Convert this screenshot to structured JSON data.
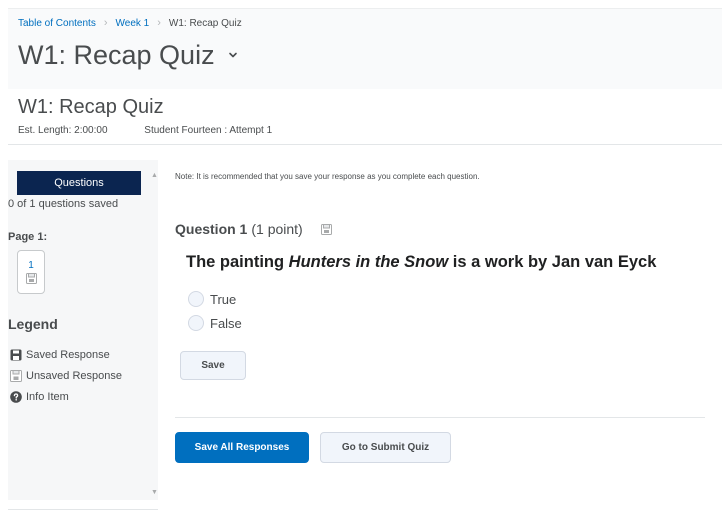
{
  "breadcrumb": {
    "items": [
      "Table of Contents",
      "Week 1",
      "W1: Recap Quiz"
    ],
    "separator": "›"
  },
  "page_title": "W1: Recap Quiz",
  "quiz": {
    "title": "W1: Recap Quiz",
    "est_length": "Est. Length: 2:00:00",
    "attempt": "Student Fourteen : Attempt 1"
  },
  "sidebar": {
    "tab": "Questions",
    "saved_count": "0 of 1 questions saved",
    "page_label": "Page 1:",
    "page_number": "1",
    "legend_title": "Legend",
    "legend": {
      "saved": "Saved Response",
      "unsaved": "Unsaved Response",
      "info": "Info Item"
    }
  },
  "note": "Note: It is recommended that you save your response as you complete each question.",
  "question": {
    "number": "Question 1",
    "points": "(1 point)",
    "text_before": "The painting ",
    "text_italic": "Hunters in the Snow",
    "text_after": " is a work by Jan van Eyck",
    "options": [
      "True",
      "False"
    ],
    "save_label": "Save"
  },
  "actions": {
    "save_all": "Save All Responses",
    "submit": "Go to Submit Quiz"
  },
  "colors": {
    "accent": "#006fbf",
    "tab_dark": "#0b2550"
  },
  "icons": {
    "title_menu": "chevron-down-icon",
    "saved": "floppy-disk-icon",
    "unsaved": "unsaved-disk-icon",
    "info": "question-circle-icon"
  }
}
